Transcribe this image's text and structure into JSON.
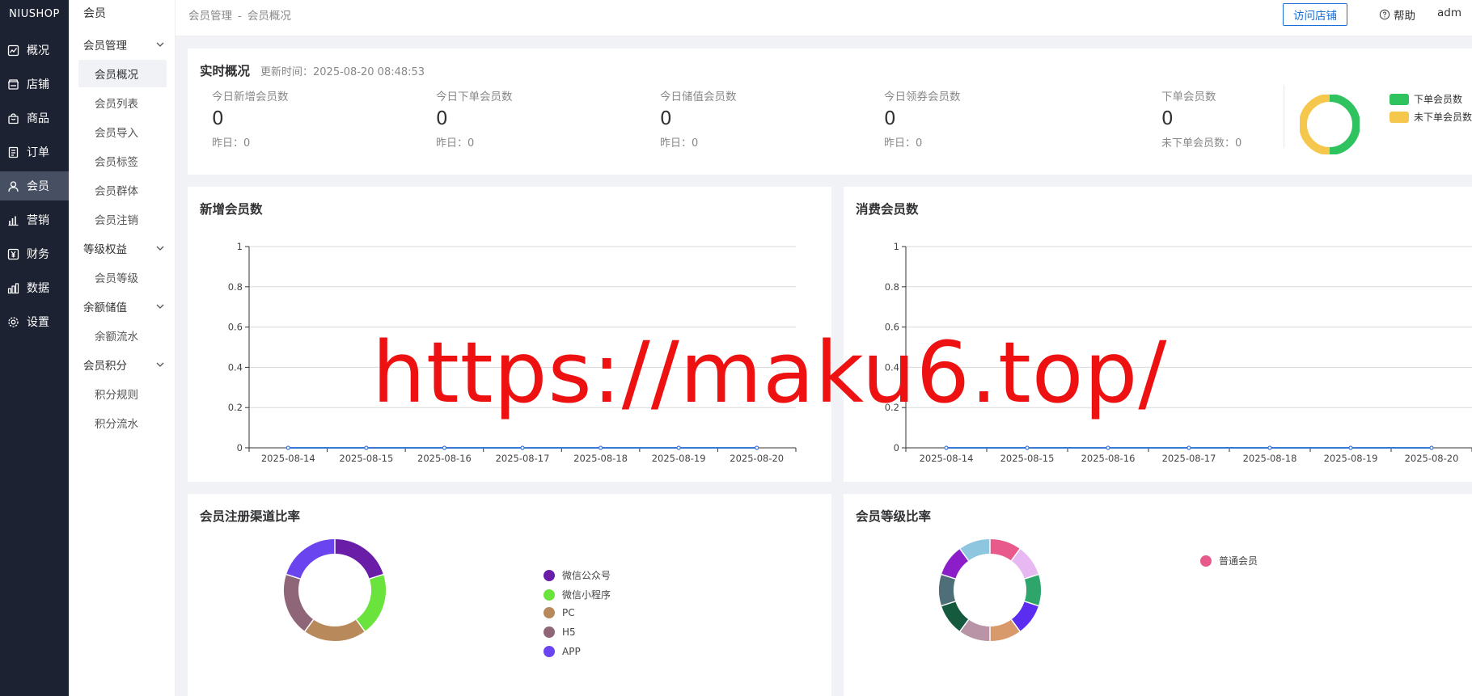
{
  "app": {
    "logo": "NIUSHOP"
  },
  "nav": [
    {
      "label": "概况",
      "icon": "chart-line-icon",
      "active": false
    },
    {
      "label": "店铺",
      "icon": "store-icon",
      "active": false
    },
    {
      "label": "商品",
      "icon": "bag-icon",
      "active": false
    },
    {
      "label": "订单",
      "icon": "order-list-icon",
      "active": false
    },
    {
      "label": "会员",
      "icon": "user-icon",
      "active": true
    },
    {
      "label": "营销",
      "icon": "bar-chart-icon",
      "active": false
    },
    {
      "label": "财务",
      "icon": "yen-icon",
      "active": false
    },
    {
      "label": "数据",
      "icon": "data-icon",
      "active": false
    },
    {
      "label": "设置",
      "icon": "gear-icon",
      "active": false
    }
  ],
  "subnav": {
    "title": "会员",
    "groups": [
      {
        "label": "会员管理",
        "items": [
          "会员概况",
          "会员列表",
          "会员导入",
          "会员标签",
          "会员群体",
          "会员注销"
        ]
      },
      {
        "label": "等级权益",
        "items": [
          "会员等级"
        ]
      },
      {
        "label": "余额储值",
        "items": [
          "余额流水"
        ]
      },
      {
        "label": "会员积分",
        "items": [
          "积分规则",
          "积分流水"
        ]
      }
    ],
    "active_item": "会员概况"
  },
  "header": {
    "breadcrumb": [
      "会员管理",
      "会员概况"
    ],
    "separator": "-",
    "visit_store": "访问店铺",
    "help": "帮助",
    "user": "adm"
  },
  "realtime": {
    "title": "实时概况",
    "update_time": "更新时间：2025-08-20 08:48:53",
    "stats": [
      {
        "label": "今日新增会员数",
        "value": "0",
        "yesterday": "昨日：0"
      },
      {
        "label": "今日下单会员数",
        "value": "0",
        "yesterday": "昨日：0"
      },
      {
        "label": "今日储值会员数",
        "value": "0",
        "yesterday": "昨日：0"
      },
      {
        "label": "今日领券会员数",
        "value": "0",
        "yesterday": "昨日：0"
      }
    ],
    "order_stat": {
      "label": "下单会员数",
      "value": "0",
      "sub": "未下单会员数：0"
    },
    "legend": [
      {
        "label": "下单会员数",
        "color": "#2ec35f"
      },
      {
        "label": "未下单会员数",
        "color": "#f5c84d"
      }
    ]
  },
  "charts": {
    "new_members": {
      "title": "新增会员数"
    },
    "consume_members": {
      "title": "消费会员数"
    },
    "register_channel": {
      "title": "会员注册渠道比率"
    },
    "member_level": {
      "title": "会员等级比率"
    }
  },
  "chart_data": [
    {
      "type": "line",
      "title": "新增会员数",
      "x": [
        "2025-08-14",
        "2025-08-15",
        "2025-08-16",
        "2025-08-17",
        "2025-08-18",
        "2025-08-19",
        "2025-08-20"
      ],
      "series": [
        {
          "values": [
            0,
            0,
            0,
            0,
            0,
            0,
            0
          ],
          "color": "#3a78d8"
        }
      ],
      "yticks": [
        "0",
        "0.2",
        "0.4",
        "0.6",
        "0.8",
        "1"
      ],
      "ylim": [
        0,
        1
      ],
      "grid": true
    },
    {
      "type": "line",
      "title": "消费会员数",
      "x": [
        "2025-08-14",
        "2025-08-15",
        "2025-08-16",
        "2025-08-17",
        "2025-08-18",
        "2025-08-19",
        "2025-08-20"
      ],
      "series": [
        {
          "values": [
            0,
            0,
            0,
            0,
            0,
            0,
            0
          ],
          "color": "#3a78d8"
        }
      ],
      "yticks": [
        "0",
        "0.2",
        "0.4",
        "0.6",
        "0.8",
        "1"
      ],
      "ylim": [
        0,
        1
      ],
      "grid": true
    },
    {
      "type": "pie",
      "title": "会员注册渠道比率",
      "labels": [
        "微信公众号",
        "微信小程序",
        "PC",
        "H5",
        "APP"
      ],
      "values": [
        1,
        1,
        1,
        1,
        1
      ],
      "colors": [
        "#6a1ea8",
        "#6ae43c",
        "#b8895a",
        "#8f6677",
        "#6a44ee"
      ]
    },
    {
      "type": "pie",
      "title": "会员等级比率",
      "labels": [
        "普通会员"
      ],
      "values": [
        0
      ],
      "colors": [
        "#e8598c"
      ],
      "ring_colors": [
        "#e8598c",
        "#e8b8f2",
        "#2ea56a",
        "#5b2df0",
        "#d89a6a",
        "#b894a6",
        "#15593e",
        "#4e6e78",
        "#8b1ec8",
        "#8ec6e0"
      ]
    }
  ],
  "watermark": "https://maku6.top/"
}
